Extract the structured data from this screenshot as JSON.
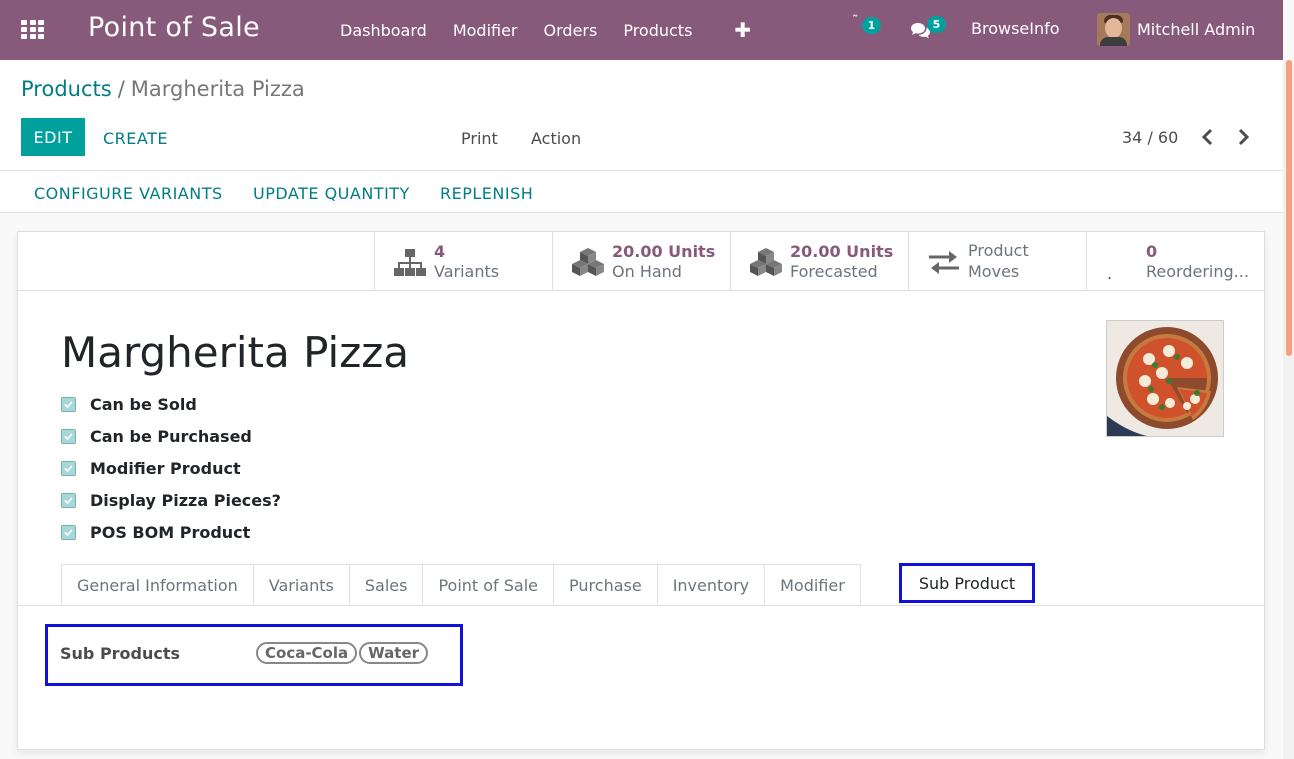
{
  "navbar": {
    "brand": "Point of Sale",
    "menu": [
      "Dashboard",
      "Modifier",
      "Orders",
      "Products"
    ],
    "plus": "✚",
    "activity_badge": "1",
    "messages_badge": "5",
    "company": "BrowseInfo",
    "user": "Mitchell Admin",
    "color": "#875a7b"
  },
  "breadcrumb": {
    "parent": "Products",
    "separator": "/",
    "current": "Margherita Pizza"
  },
  "actions": {
    "edit": "EDIT",
    "create": "CREATE",
    "print": "Print",
    "action": "Action"
  },
  "pager": {
    "value": "34 / 60"
  },
  "header_buttons": [
    "CONFIGURE VARIANTS",
    "UPDATE QUANTITY",
    "REPLENISH"
  ],
  "smart_buttons": {
    "variants": {
      "value": "4",
      "label": "Variants"
    },
    "on_hand": {
      "value": "20.00 Units",
      "label": "On Hand"
    },
    "forecasted": {
      "value": "20.00 Units",
      "label": "Forecasted"
    },
    "moves": {
      "line1": "Product",
      "line2": "Moves"
    },
    "reordering": {
      "value": "0",
      "label": "Reordering...",
      "prefix": "."
    }
  },
  "product": {
    "name": "Margherita Pizza",
    "checks": [
      "Can be Sold",
      "Can be Purchased",
      "Modifier Product",
      "Display Pizza Pieces?",
      "POS BOM Product"
    ]
  },
  "tabs": [
    "General Information",
    "Variants",
    "Sales",
    "Point of Sale",
    "Purchase",
    "Inventory",
    "Modifier"
  ],
  "active_tab": "Sub Product",
  "sub_products": {
    "label": "Sub Products",
    "tags": [
      "Coca-Cola",
      "Water"
    ]
  },
  "colors": {
    "primary": "#00a09d",
    "link": "#017e84",
    "highlight": "#1111d8",
    "accent": "#875a7b"
  }
}
